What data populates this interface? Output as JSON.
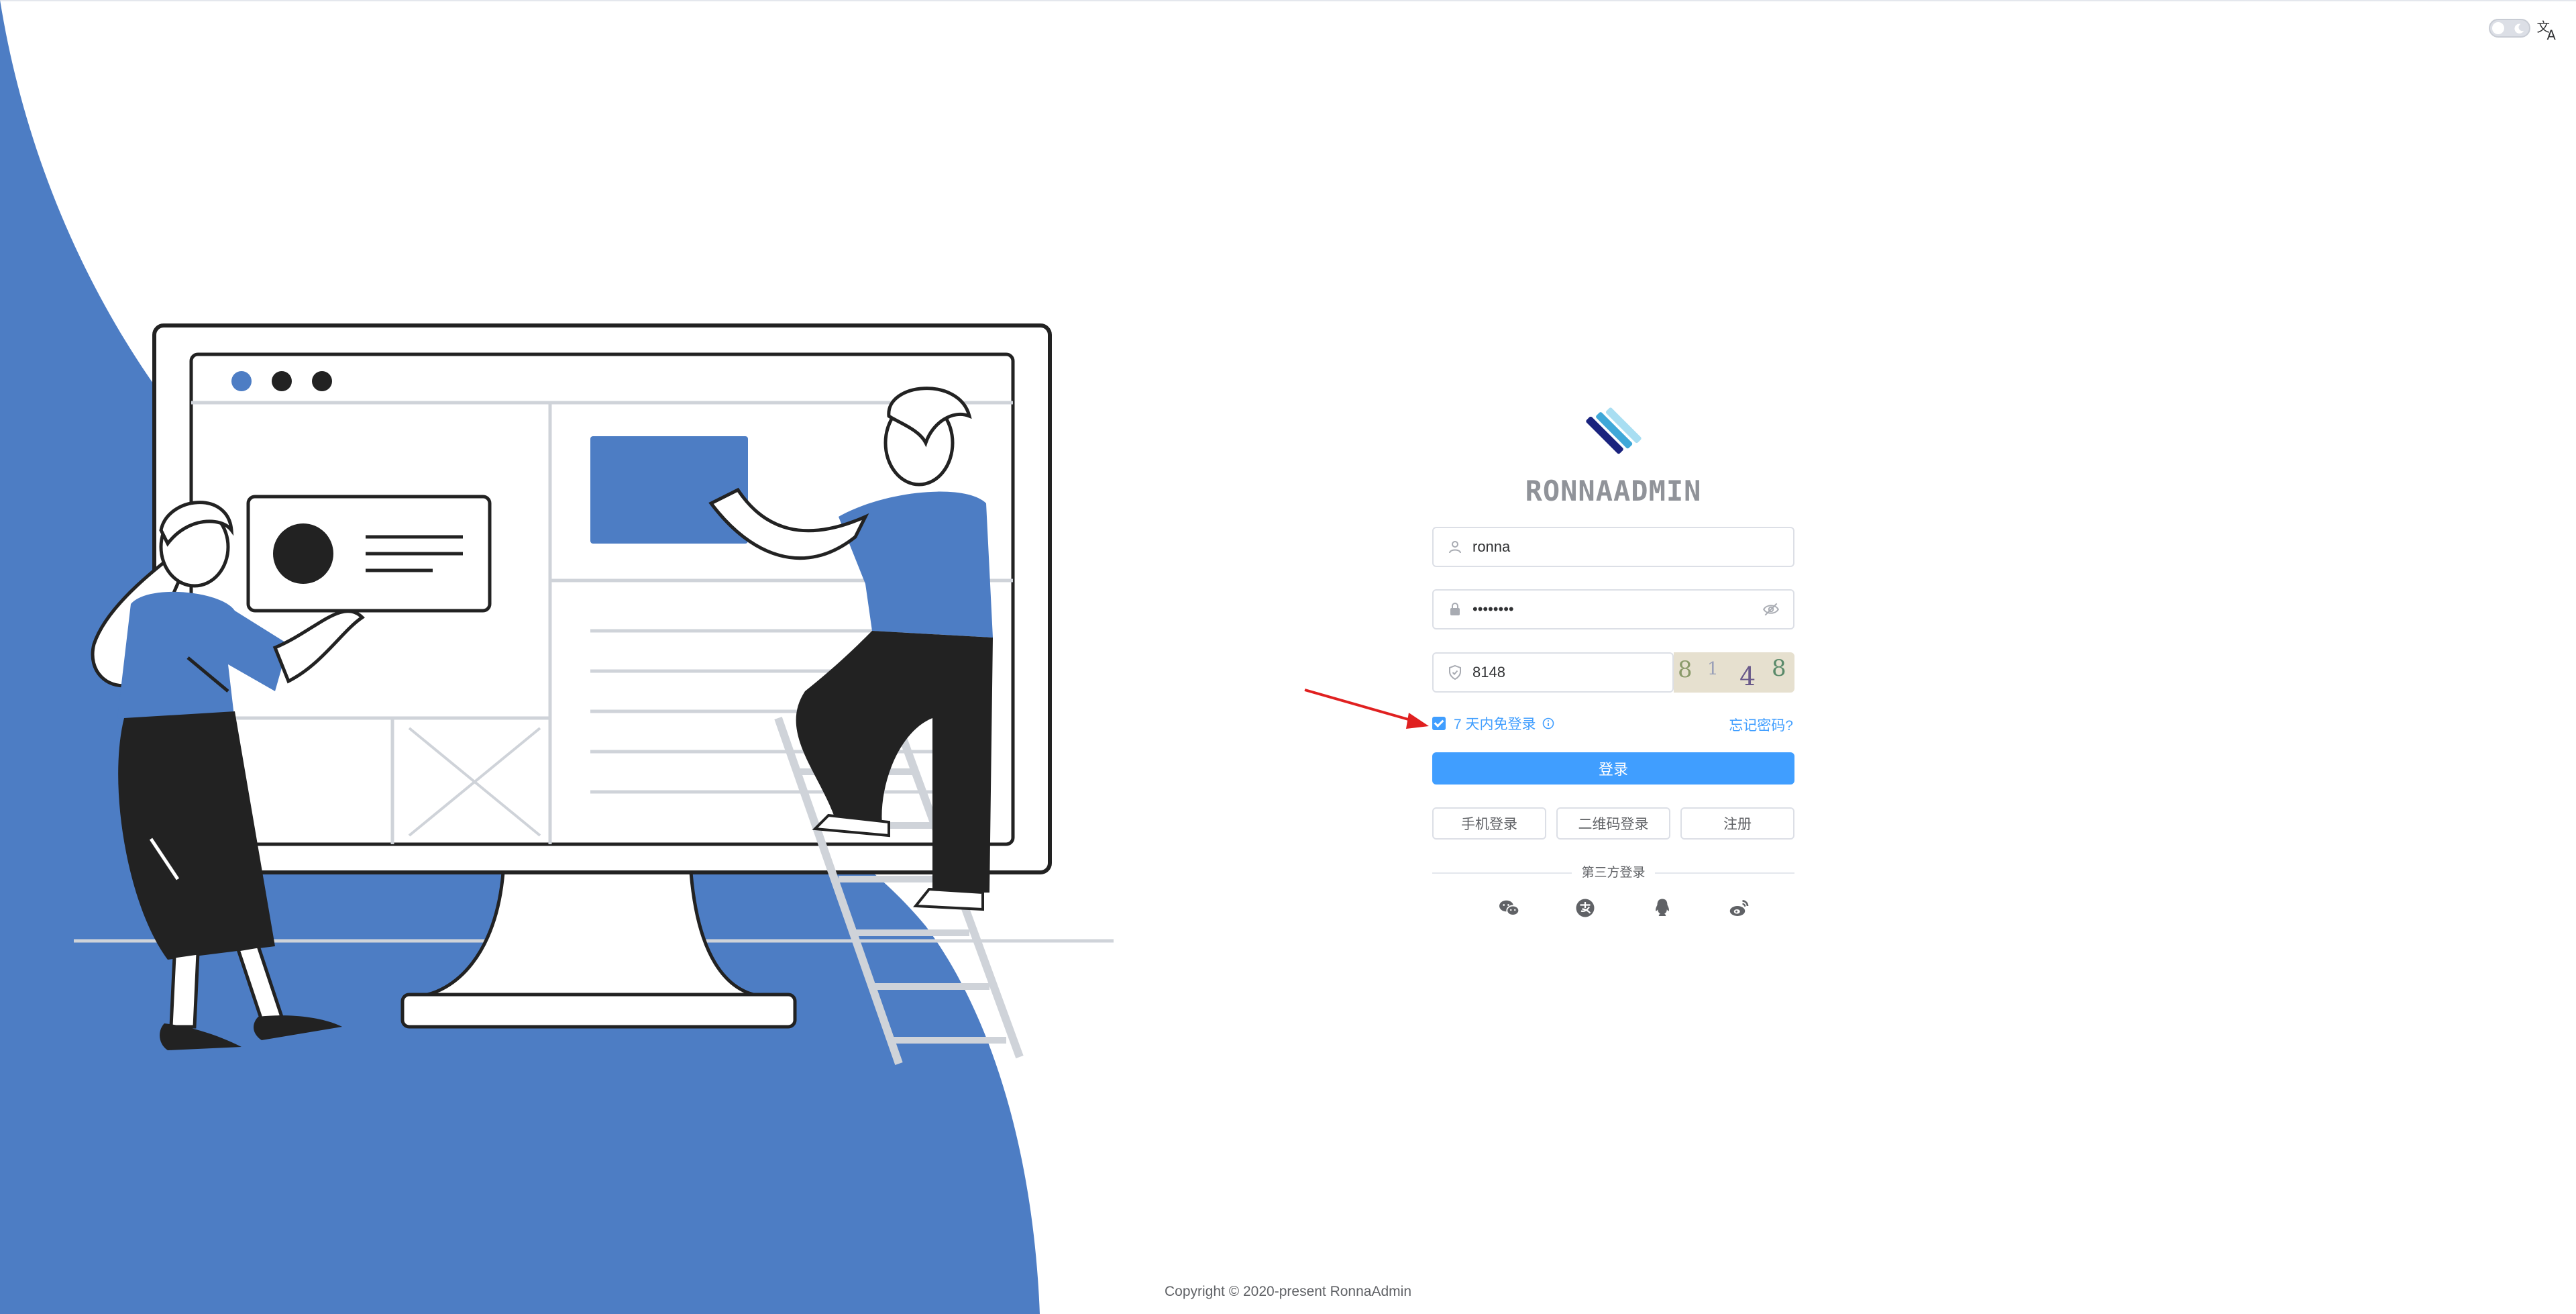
{
  "header": {
    "dark_mode_icon": "moon-icon",
    "language_icon": "translate-icon"
  },
  "brand": {
    "title": "RONNAADMIN",
    "colors": {
      "accent": "#409eff",
      "illustration": "#4d7dc4"
    }
  },
  "login": {
    "username_value": "ronna",
    "password_value": "••••••••",
    "captcha_input_value": "8148",
    "captcha_image_text": "8148",
    "remember_label": "7 天内免登录",
    "remember_checked": true,
    "forgot_link": "忘记密码?",
    "submit_label": "登录",
    "phone_login_label": "手机登录",
    "qr_login_label": "二维码登录",
    "register_label": "注册",
    "third_party_label": "第三方登录",
    "third_party_icons": [
      "wechat-icon",
      "alipay-icon",
      "qq-icon",
      "weibo-icon"
    ]
  },
  "footer": {
    "copyright": "Copyright © 2020-present RonnaAdmin"
  }
}
